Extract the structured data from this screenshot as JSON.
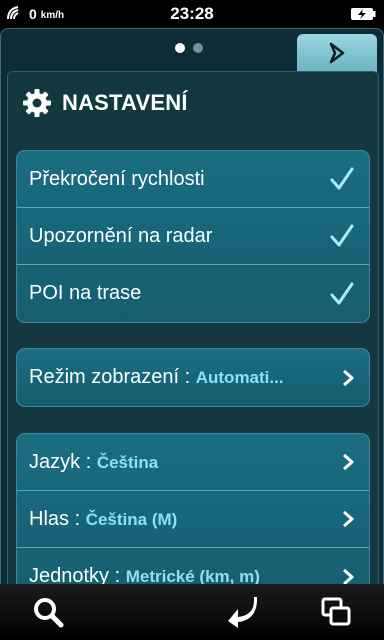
{
  "status": {
    "speed": "0",
    "speed_unit": "km/h",
    "time": "23:28"
  },
  "pager": {
    "pages": 2,
    "active": 0
  },
  "settings": {
    "title": "NASTAVENÍ",
    "alerts": [
      {
        "label": "Překročení rychlosti",
        "checked": true
      },
      {
        "label": "Upozornění na radar",
        "checked": true
      },
      {
        "label": "POI na trase",
        "checked": true
      }
    ],
    "display": {
      "label": "Režim zobrazení :",
      "value": "Automati..."
    },
    "general": [
      {
        "label": "Jazyk :",
        "value": "Čeština"
      },
      {
        "label": "Hlas :",
        "value": "Čeština (M)"
      },
      {
        "label": "Jednotky :",
        "value": "Metrické (km, m)"
      }
    ]
  },
  "colors": {
    "accent": "#8fe0f0",
    "panel": "#0d2c35",
    "row": "#1a6d82"
  }
}
